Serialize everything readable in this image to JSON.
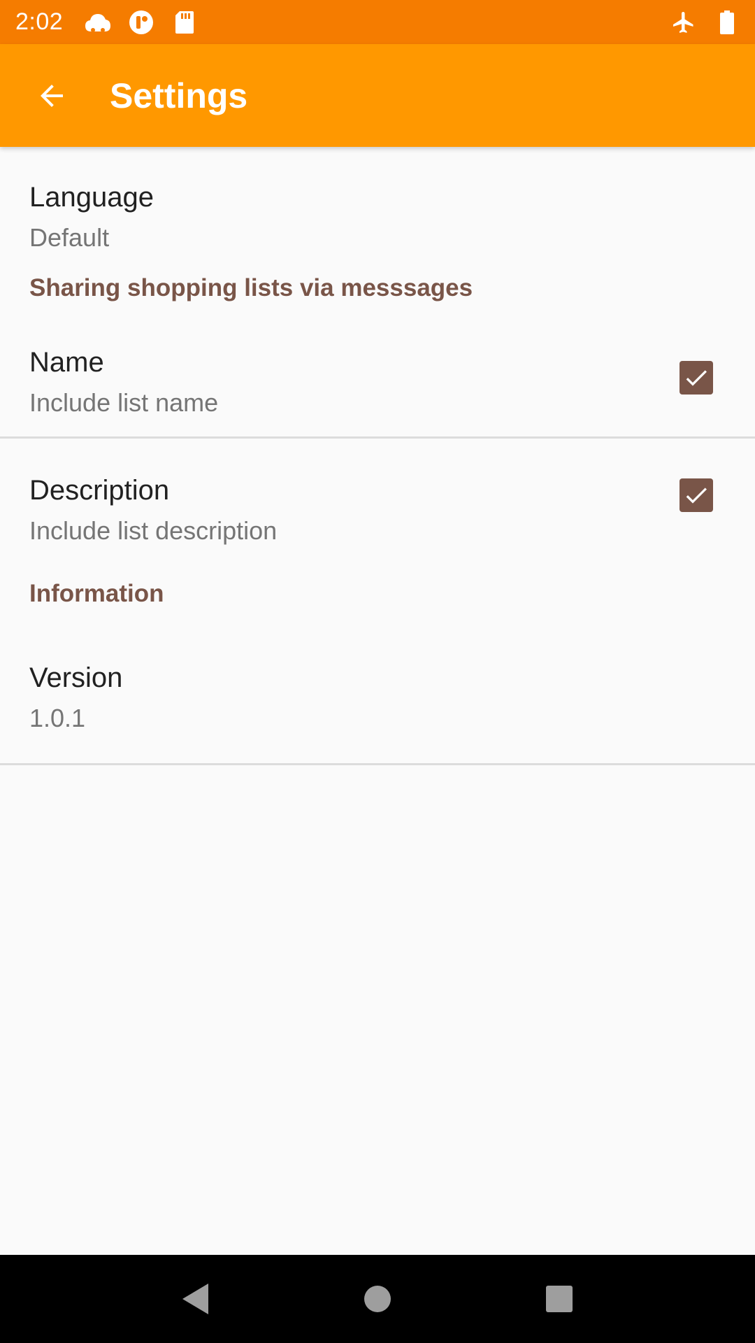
{
  "status_bar": {
    "time": "2:02",
    "icons_left": [
      "cloud-icon",
      "app-icon",
      "sd-card-icon"
    ],
    "icons_right": [
      "airplane-icon",
      "battery-icon"
    ],
    "color": "#f57c00"
  },
  "app_bar": {
    "title": "Settings",
    "color": "#ff9800"
  },
  "preferences": {
    "language": {
      "title": "Language",
      "summary": "Default"
    },
    "sharing_category": "Sharing shopping lists via messsages",
    "name": {
      "title": "Name",
      "summary": "Include list name",
      "checked": true
    },
    "description": {
      "title": "Description",
      "summary": "Include list description",
      "checked": true
    },
    "information_category": "Information",
    "version": {
      "title": "Version",
      "summary": "1.0.1"
    }
  },
  "accent_color": "#795548",
  "nav_bar": {
    "buttons": [
      "back-triangle-icon",
      "home-circle-icon",
      "recents-square-icon"
    ]
  }
}
